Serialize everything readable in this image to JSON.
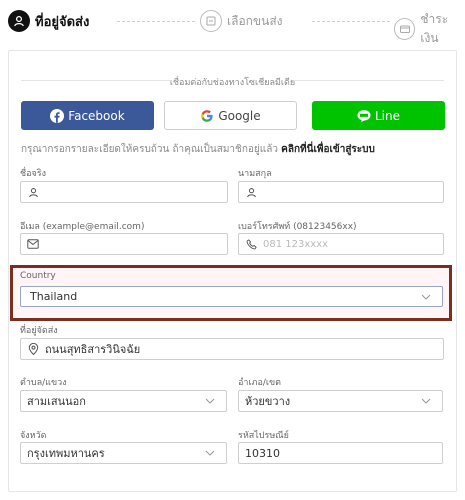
{
  "steps": [
    {
      "label": "ที่อยู่จัดส่ง",
      "active": true,
      "icon": "user-icon"
    },
    {
      "label": "เลือกขนส่ง",
      "active": false,
      "icon": "truck-icon"
    },
    {
      "label": "ชำระเงิน",
      "active": false,
      "icon": "card-icon"
    }
  ],
  "social": {
    "title": "เชื่อมต่อกับช่องทางโซเชียลมีเดีย",
    "facebook": "Facebook",
    "google": "Google",
    "line": "Line",
    "facebook_color": "#3b5998",
    "line_color": "#00c300"
  },
  "hint": {
    "text": "กรุณากรอกรายละเอียดให้ครบถ้วน ถ้าคุณเป็นสมาชิกอยู่แล้ว",
    "link": "คลิกที่นี่เพื่อเข้าสู่ระบบ"
  },
  "form": {
    "first_name": {
      "label": "ชื่อจริง",
      "value": ""
    },
    "last_name": {
      "label": "นามสกุล",
      "value": ""
    },
    "email": {
      "label": "อีเมล (example@email.com)",
      "value": ""
    },
    "phone": {
      "label": "เบอร์โทรศัพท์ (08123456xx)",
      "placeholder": "081 123xxxx"
    },
    "country": {
      "label": "Country",
      "value": "Thailand"
    },
    "address": {
      "label": "ที่อยู่จัดส่ง",
      "value": "ถนนสุทธิสารวินิจฉัย"
    },
    "subdistrict": {
      "label": "ตำบล/แขวง",
      "value": "สามเสนนอก"
    },
    "district": {
      "label": "อำเภอ/เขต",
      "value": "ห้วยขวาง"
    },
    "province": {
      "label": "จังหวัด",
      "value": "กรุงเทพมหานคร"
    },
    "postcode": {
      "label": "รหัสไปรษณีย์",
      "value": "10310"
    }
  },
  "highlight_color": "#7b2d1f"
}
